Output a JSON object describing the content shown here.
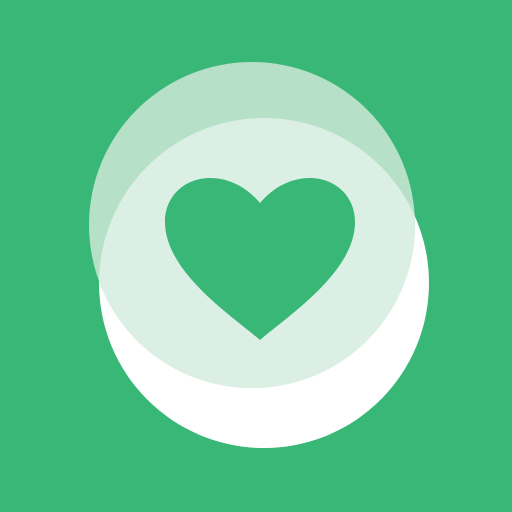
{
  "icon": {
    "name": "heart-icon",
    "colors": {
      "background": "#39b777",
      "bottom_circle": "#ffffff",
      "middle_circle": "#b6e0c7",
      "top_circle": "#dcefe4",
      "heart": "#39b777"
    }
  }
}
